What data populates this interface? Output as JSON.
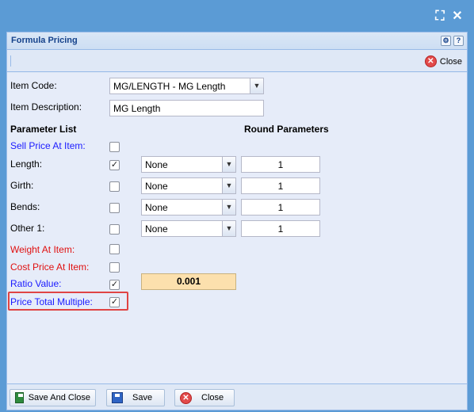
{
  "window": {
    "title": "Formula Pricing",
    "fullscreen_glyph": "⛶",
    "close_glyph": "✕"
  },
  "panel_tools": {
    "gear": "⚙",
    "help": "?"
  },
  "toolbar": {
    "close_label": "Close"
  },
  "form": {
    "item_code_label": "Item Code:",
    "item_code_value": "MG/LENGTH - MG Length",
    "item_description_label": "Item Description:",
    "item_description_value": "MG Length",
    "parameter_list_heading": "Parameter List",
    "round_parameters_heading": "Round Parameters"
  },
  "parameters": [
    {
      "label": "Sell Price At Item:",
      "checked": false,
      "color": "#1a1aff"
    },
    {
      "label": "Length:",
      "checked": true,
      "color": "#000000",
      "round": "None",
      "value": "1"
    },
    {
      "label": "Girth:",
      "checked": false,
      "color": "#000000",
      "round": "None",
      "value": "1"
    },
    {
      "label": "Bends:",
      "checked": false,
      "color": "#000000",
      "round": "None",
      "value": "1"
    },
    {
      "label": "Other 1:",
      "checked": false,
      "color": "#000000",
      "round": "None",
      "value": "1"
    },
    {
      "label": "Weight At Item:",
      "checked": false,
      "color": "#e01010"
    },
    {
      "label": "Cost Price At Item:",
      "checked": false,
      "color": "#e01010"
    },
    {
      "label": "Ratio Value:",
      "checked": true,
      "color": "#1a1aff",
      "ratio": "0.001"
    },
    {
      "label": "Price Total Multiple:",
      "checked": true,
      "color": "#1a1aff"
    }
  ],
  "footer": {
    "save_and_close": "Save And Close",
    "save": "Save",
    "close": "Close"
  },
  "icons": {
    "check": "✓",
    "dropdown": "▼",
    "close_x": "✕"
  }
}
